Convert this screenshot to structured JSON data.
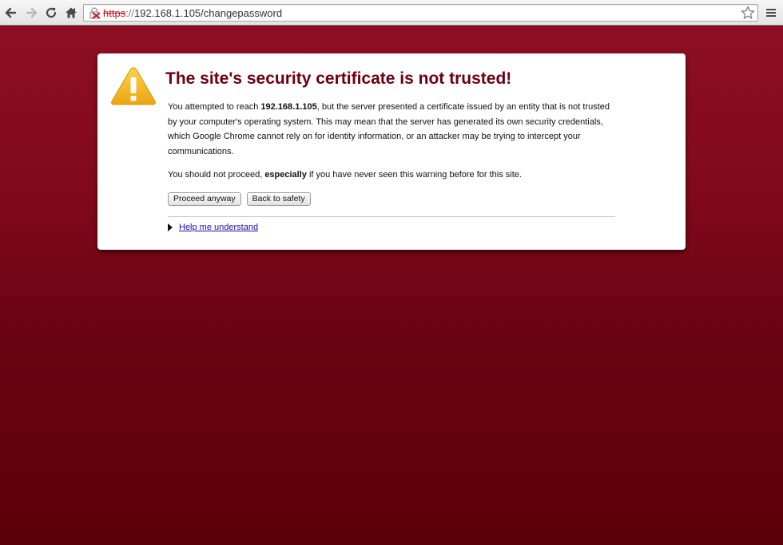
{
  "browser": {
    "url_scheme": "https",
    "url_separator": "://",
    "url_rest": "192.168.1.105/changepassword",
    "icons": [
      "back-arrow-icon",
      "forward-arrow-icon",
      "reload-icon",
      "home-icon",
      "broken-lock-icon",
      "star-icon",
      "menu-icon"
    ]
  },
  "interstitial": {
    "title": "The site's security certificate is not trusted!",
    "p1_before": "You attempted to reach ",
    "p1_host": "192.168.1.105",
    "p1_after": ", but the server presented a certificate issued by an entity that is not trusted by your computer's operating system. This may mean that the server has generated its own security credentials, which Google Chrome cannot rely on for identity information, or an attacker may be trying to intercept your communications.",
    "p2_before": "You should not proceed, ",
    "p2_bold": "especially",
    "p2_after": " if you have never seen this warning before for this site.",
    "proceed_label": "Proceed anyway",
    "back_label": "Back to safety",
    "help_label": "Help me understand"
  },
  "colors": {
    "page_background_top": "#8d0e22",
    "page_background_bottom": "#5c0008",
    "title": "#6a0010",
    "link": "#1a0dab",
    "warning_icon": "#f2b820"
  }
}
